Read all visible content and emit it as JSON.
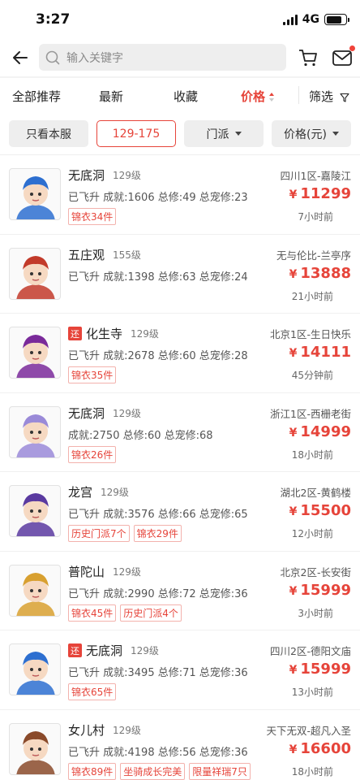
{
  "status": {
    "time": "3:27",
    "network": "4G"
  },
  "search": {
    "placeholder": "输入关键字"
  },
  "sort_tabs": [
    "全部推荐",
    "最新",
    "收藏",
    "价格",
    "筛选"
  ],
  "filters": {
    "only_server": "只看本服",
    "level_range": "129-175",
    "sect": "门派",
    "price_unit": "价格(元)"
  },
  "colors": {
    "accent": "#e6443a"
  },
  "listings": [
    {
      "sect": "无底洞",
      "level": "129级",
      "server": "四川1区-嘉陵江",
      "stats": "已飞升 成就:1606 总修:49 总宠修:23",
      "tags": [
        "锦衣34件"
      ],
      "price": "11299",
      "ago": "7小时前",
      "returned": false,
      "avatar_color": "#2d6fd0"
    },
    {
      "sect": "五庄观",
      "level": "155级",
      "server": "无与伦比-兰亭序",
      "stats": "已飞升 成就:1398 总修:63 总宠修:24",
      "tags": [],
      "price": "13888",
      "ago": "21小时前",
      "returned": false,
      "avatar_color": "#c23a2a"
    },
    {
      "sect": "化生寺",
      "level": "129级",
      "server": "北京1区-生日快乐",
      "stats": "已飞升 成就:2678 总修:60 总宠修:28",
      "tags": [
        "锦衣35件"
      ],
      "price": "14111",
      "ago": "45分钟前",
      "returned": true,
      "returned_label": "还",
      "avatar_color": "#7a2a9a"
    },
    {
      "sect": "无底洞",
      "level": "129级",
      "server": "浙江1区-西栅老街",
      "stats": "成就:2750 总修:60 总宠修:68",
      "tags": [
        "锦衣26件"
      ],
      "price": "14999",
      "ago": "18小时前",
      "returned": false,
      "avatar_color": "#9a8ad8"
    },
    {
      "sect": "龙宫",
      "level": "129级",
      "server": "湖北2区-黄鹤楼",
      "stats": "已飞升 成就:3576 总修:66 总宠修:65",
      "tags": [
        "历史门派7个",
        "锦衣29件"
      ],
      "price": "15500",
      "ago": "12小时前",
      "returned": false,
      "avatar_color": "#5a3aa0"
    },
    {
      "sect": "普陀山",
      "level": "129级",
      "server": "北京2区-长安街",
      "stats": "已飞升 成就:2990 总修:72 总宠修:36",
      "tags": [
        "锦衣45件",
        "历史门派4个"
      ],
      "price": "15999",
      "ago": "3小时前",
      "returned": false,
      "avatar_color": "#d8a030"
    },
    {
      "sect": "无底洞",
      "level": "129级",
      "server": "四川2区-德阳文庙",
      "stats": "已飞升 成就:3495 总修:71 总宠修:36",
      "tags": [
        "锦衣65件"
      ],
      "price": "15999",
      "ago": "13小时前",
      "returned": true,
      "returned_label": "还",
      "avatar_color": "#2d6fd0"
    },
    {
      "sect": "女儿村",
      "level": "129级",
      "server": "天下无双-超凡入圣",
      "stats": "已飞升 成就:4198 总修:56 总宠修:36",
      "tags": [
        "锦衣89件",
        "坐骑成长完美",
        "限量祥瑞7只"
      ],
      "price": "16600",
      "ago": "18小时前",
      "returned": false,
      "avatar_color": "#8a4a2a"
    }
  ],
  "currency_symbol": "¥"
}
